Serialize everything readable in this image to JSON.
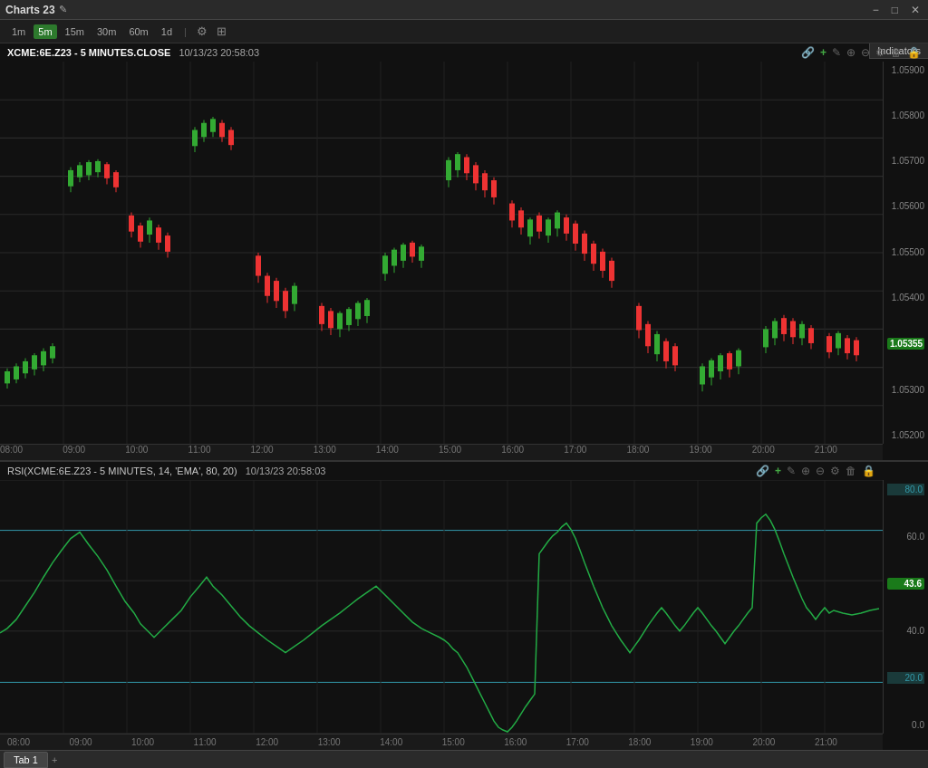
{
  "titleBar": {
    "title": "Charts 23",
    "editIcon": "✎",
    "controls": [
      "−",
      "□",
      "✕"
    ]
  },
  "mainChart": {
    "headerText": "XCME:6E.Z23 - 5 MINUTES.CLOSE",
    "timestamp": "10/13/23 20:58:03",
    "timeframes": [
      "1m",
      "5m",
      "15m",
      "30m",
      "60m",
      "1d"
    ],
    "activeTimeframe": "5m",
    "priceLabels": [
      "1.05900",
      "1.05800",
      "1.05700",
      "1.05600",
      "1.05500",
      "1.05400",
      "1.05355",
      "1.05300",
      "1.05200"
    ],
    "currentPrice": "1.05355",
    "timeLabels": [
      "08:00",
      "09:00",
      "10:00",
      "11:00",
      "12:00",
      "13:00",
      "14:00",
      "15:00",
      "16:00",
      "17:00",
      "18:00",
      "19:00",
      "20:00",
      "21:00"
    ]
  },
  "rsiPanel": {
    "headerText": "RSI(XCME:6E.Z23 - 5 MINUTES, 14, 'EMA', 80, 20)",
    "timestamp": "10/13/23 20:58:03",
    "levels": {
      "upper": "80.0",
      "middle": "60.0",
      "current": "43.6",
      "lower1": "40.0",
      "lower2": "20.0",
      "zero": "0.0"
    },
    "timeLabels": [
      "08:00",
      "09:00",
      "10:00",
      "11:00",
      "12:00",
      "13:00",
      "14:00",
      "15:00",
      "16:00",
      "17:00",
      "18:00",
      "19:00",
      "20:00",
      "21:00"
    ]
  },
  "indicators": {
    "label": "Indicators"
  },
  "bottomTabs": [
    {
      "label": "Tab 1",
      "active": true
    }
  ],
  "toolbarIcons": {
    "link": "🔗",
    "plus": "+",
    "pencil": "✎",
    "zoomIn": "🔍",
    "zoomOut": "🔎",
    "gear": "⚙",
    "trash": "🗑",
    "lock": "🔒"
  }
}
